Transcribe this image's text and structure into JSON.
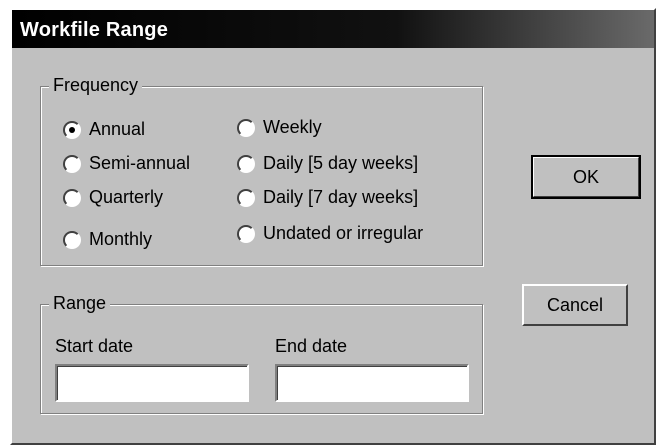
{
  "window": {
    "title": "Workfile Range"
  },
  "frequency": {
    "group_label": "Frequency",
    "options": [
      {
        "label": "Annual",
        "checked": true
      },
      {
        "label": "Semi-annual",
        "checked": false
      },
      {
        "label": "Quarterly",
        "checked": false
      },
      {
        "label": "Monthly",
        "checked": false
      },
      {
        "label": "Weekly",
        "checked": false
      },
      {
        "label": "Daily [5 day weeks]",
        "checked": false
      },
      {
        "label": "Daily [7 day weeks]",
        "checked": false
      },
      {
        "label": "Undated or irregular",
        "checked": false
      }
    ]
  },
  "range": {
    "group_label": "Range",
    "start_label": "Start date",
    "start_value": "",
    "end_label": "End date",
    "end_value": ""
  },
  "buttons": {
    "ok": "OK",
    "cancel": "Cancel"
  }
}
